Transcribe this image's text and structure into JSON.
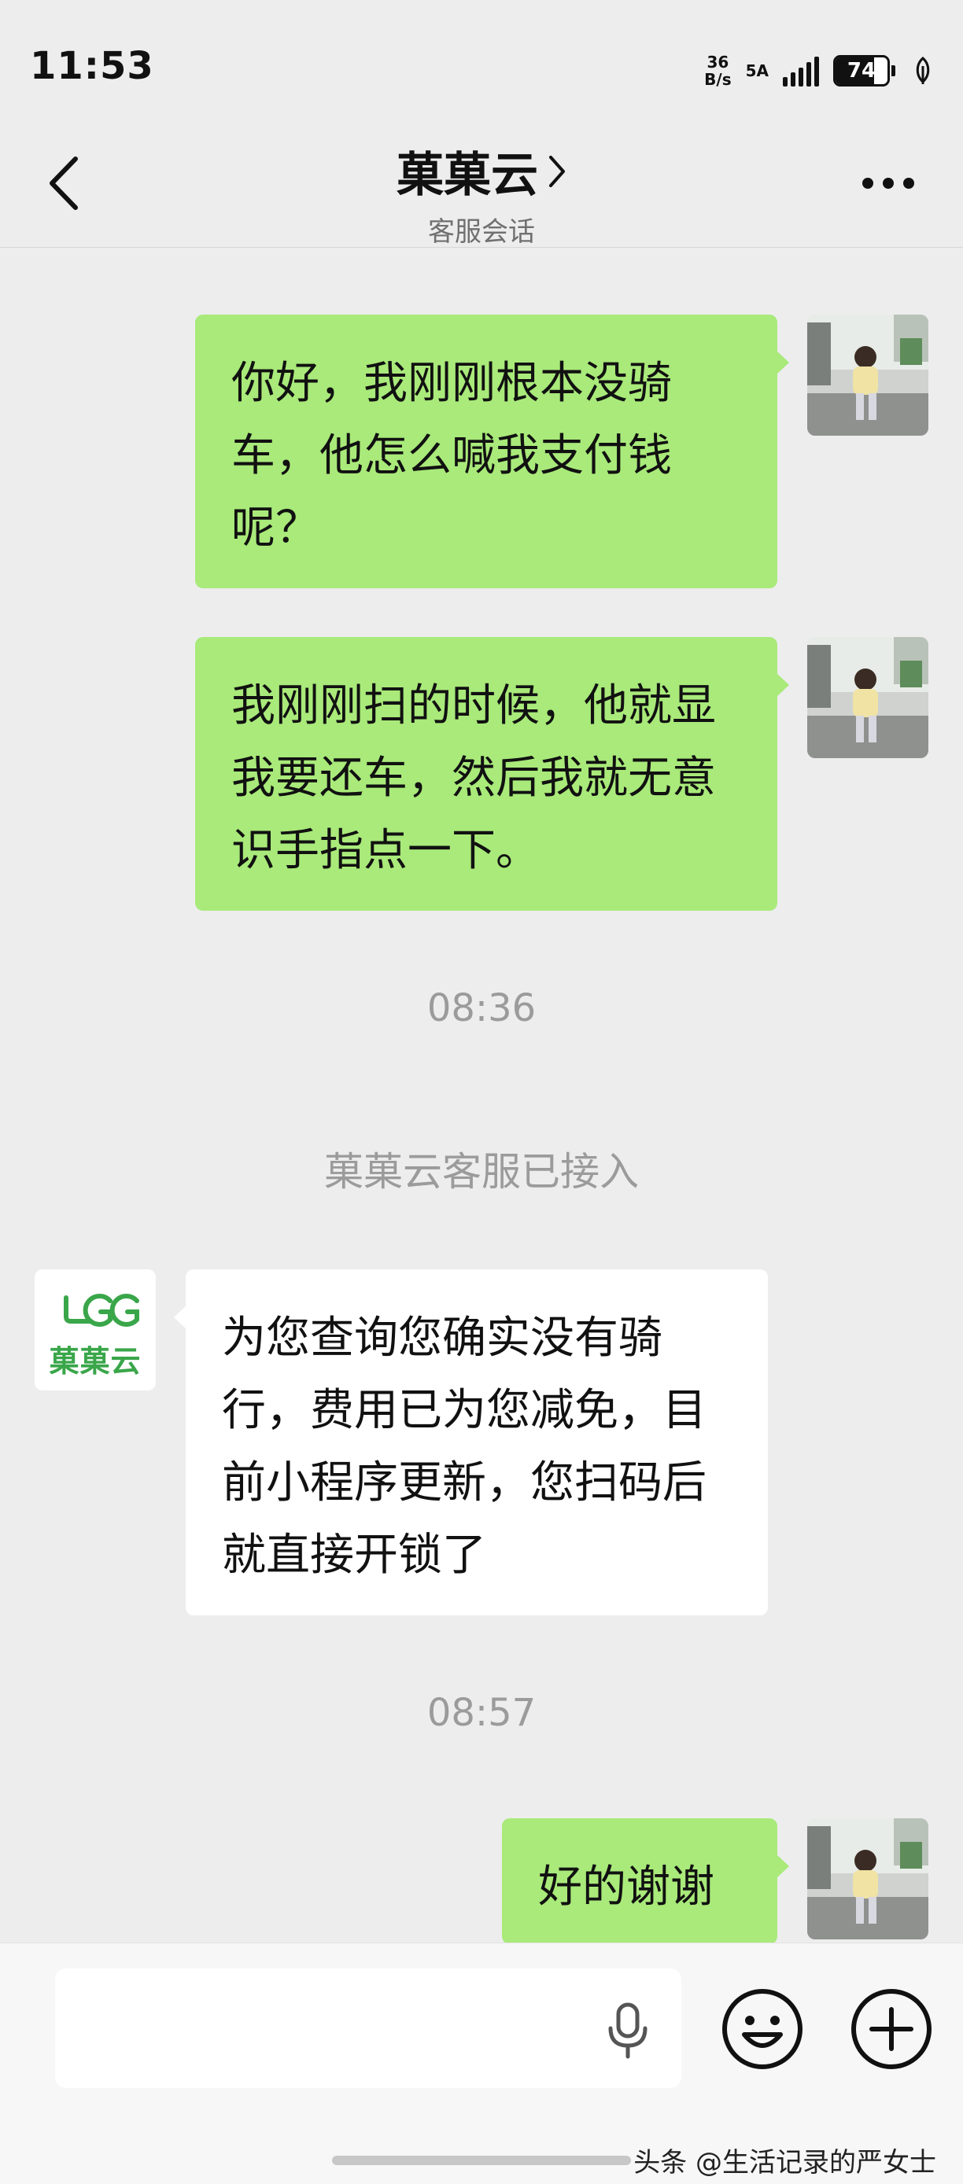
{
  "status_bar": {
    "time": "11:53",
    "net_speed_top": "36",
    "net_speed_bottom": "B/s",
    "network_type": "5A",
    "battery_percent": "74",
    "battery_level": 0.74
  },
  "header": {
    "title": "菓菓云",
    "subtitle": "客服会话",
    "back_icon": "chevron-left-icon",
    "more_icon": "more-dots-icon"
  },
  "messages": [
    {
      "side": "mine",
      "text": "你好，我刚刚根本没骑车，他怎么喊我支付钱呢？"
    },
    {
      "side": "mine",
      "text": "我刚刚扫的时候，他就显我要还车，然后我就无意识手指点一下。"
    },
    {
      "side": "system",
      "text": "08:36"
    },
    {
      "side": "system",
      "text": "菓菓云客服已接入"
    },
    {
      "side": "theirs",
      "text": "为您查询您确实没有骑行，费用已为您减免，目前小程序更新，您扫码后就直接开锁了"
    },
    {
      "side": "system",
      "text": "08:57"
    },
    {
      "side": "mine",
      "text": "好的谢谢"
    }
  ],
  "service_logo_text": "菓菓云",
  "input_bar": {
    "value": "",
    "voice_icon": "microphone-icon",
    "emoji_icon": "emoji-icon",
    "plus_icon": "plus-circle-icon"
  },
  "watermark": "头条 @生活记录的严女士",
  "colors": {
    "background": "#ededed",
    "my_bubble": "#a9ea7a",
    "their_bubble": "#ffffff",
    "system_text": "#9b9b9b",
    "logo_green": "#3aa64a"
  }
}
